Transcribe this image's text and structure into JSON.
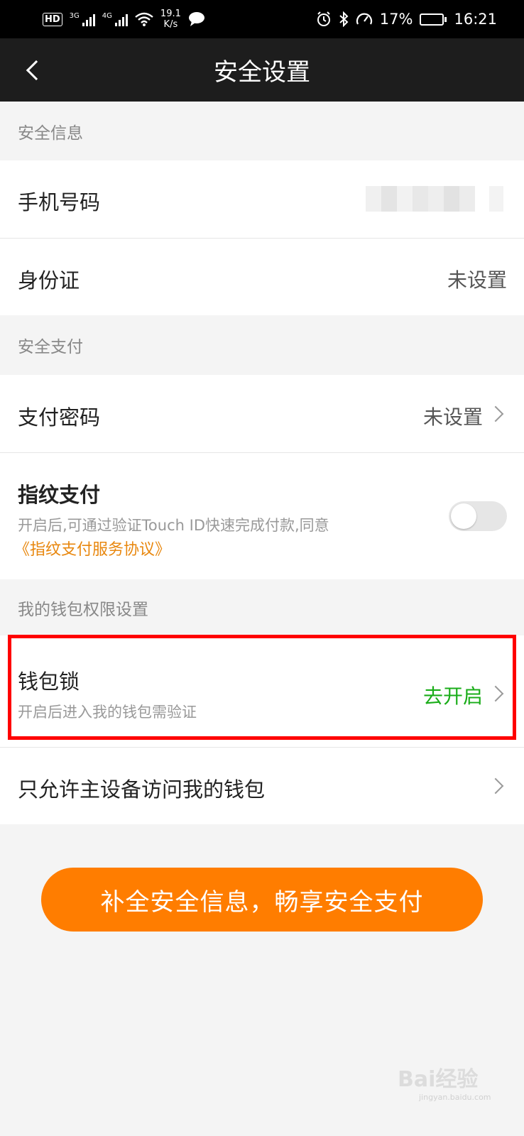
{
  "status_bar": {
    "hd_label": "HD",
    "sim1": "3G",
    "sim2": "4G",
    "net_speed_value": "19.1",
    "net_speed_unit": "K/s",
    "battery_percent": "17%",
    "battery_level": 0.17,
    "time": "16:21"
  },
  "nav": {
    "title": "安全设置"
  },
  "sections": {
    "security_info": "安全信息",
    "secure_payment": "安全支付",
    "wallet_permissions": "我的钱包权限设置"
  },
  "rows": {
    "phone": {
      "label": "手机号码"
    },
    "id_card": {
      "label": "身份证",
      "value": "未设置"
    },
    "pay_password": {
      "label": "支付密码",
      "value": "未设置"
    },
    "fingerprint": {
      "label": "指纹支付",
      "desc": "开启后,可通过验证Touch ID快速完成付款,同意",
      "agreement_link": "《指纹支付服务协议》",
      "enabled": false
    },
    "wallet_lock": {
      "label": "钱包锁",
      "desc": "开启后进入我的钱包需验证",
      "action": "去开启"
    },
    "main_device": {
      "label": "只允许主设备访问我的钱包"
    }
  },
  "cta": {
    "label": "补全安全信息，畅享安全支付"
  },
  "watermark": {
    "brand": "Bai经验",
    "url": "jingyan.baidu.com"
  },
  "colors": {
    "accent": "#ff7d00",
    "link": "#e8870e",
    "action_green": "#1aad19",
    "highlight": "#ff0000"
  }
}
